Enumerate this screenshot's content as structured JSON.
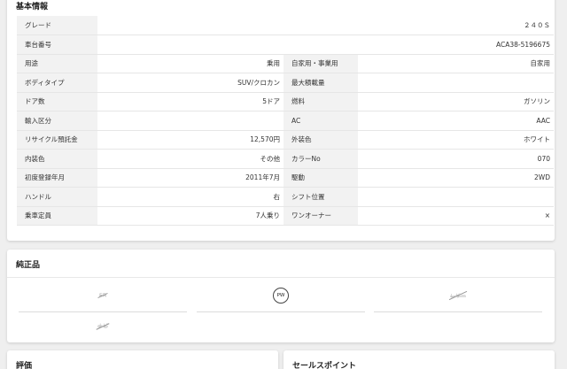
{
  "basic": {
    "title": "基本情報",
    "rows": [
      {
        "k1": "グレード",
        "v1": "",
        "k2": "",
        "v2": "２４０Ｓ",
        "full": true
      },
      {
        "k1": "車台番号",
        "v1": "",
        "k2": "",
        "v2": "ACA38-5196675",
        "full": true
      },
      {
        "k1": "用途",
        "v1": "乗用",
        "k2": "自家用・事業用",
        "v2": "自家用"
      },
      {
        "k1": "ボディタイプ",
        "v1": "SUV/クロカン",
        "k2": "最大積載量",
        "v2": ""
      },
      {
        "k1": "ドア数",
        "v1": "5ドア",
        "k2": "燃料",
        "v2": "ガソリン"
      },
      {
        "k1": "輸入区分",
        "v1": "",
        "k2": "AC",
        "v2": "AAC"
      },
      {
        "k1": "リサイクル預託金",
        "v1": "12,570円",
        "k2": "外装色",
        "v2": "ホワイト"
      },
      {
        "k1": "内装色",
        "v1": "その他",
        "k2": "カラーNo",
        "v2": "070"
      },
      {
        "k1": "初度登録年月",
        "v1": "2011年7月",
        "k2": "駆動",
        "v2": "2WD"
      },
      {
        "k1": "ハンドル",
        "v1": "右",
        "k2": "シフト位置",
        "v2": ""
      },
      {
        "k1": "乗車定員",
        "v1": "7人乗り",
        "k2": "ワンオーナー",
        "v2": "×"
      }
    ]
  },
  "genuine": {
    "title": "純正品",
    "options": [
      {
        "label": "SR",
        "state": "off"
      },
      {
        "label": "PW",
        "state": "on"
      },
      {
        "label": "レザー",
        "state": "off"
      },
      {
        "label": "ナビ",
        "state": "off"
      }
    ]
  },
  "evaluation": {
    "title": "評価"
  },
  "sales_point": {
    "title": "セールスポイント"
  }
}
